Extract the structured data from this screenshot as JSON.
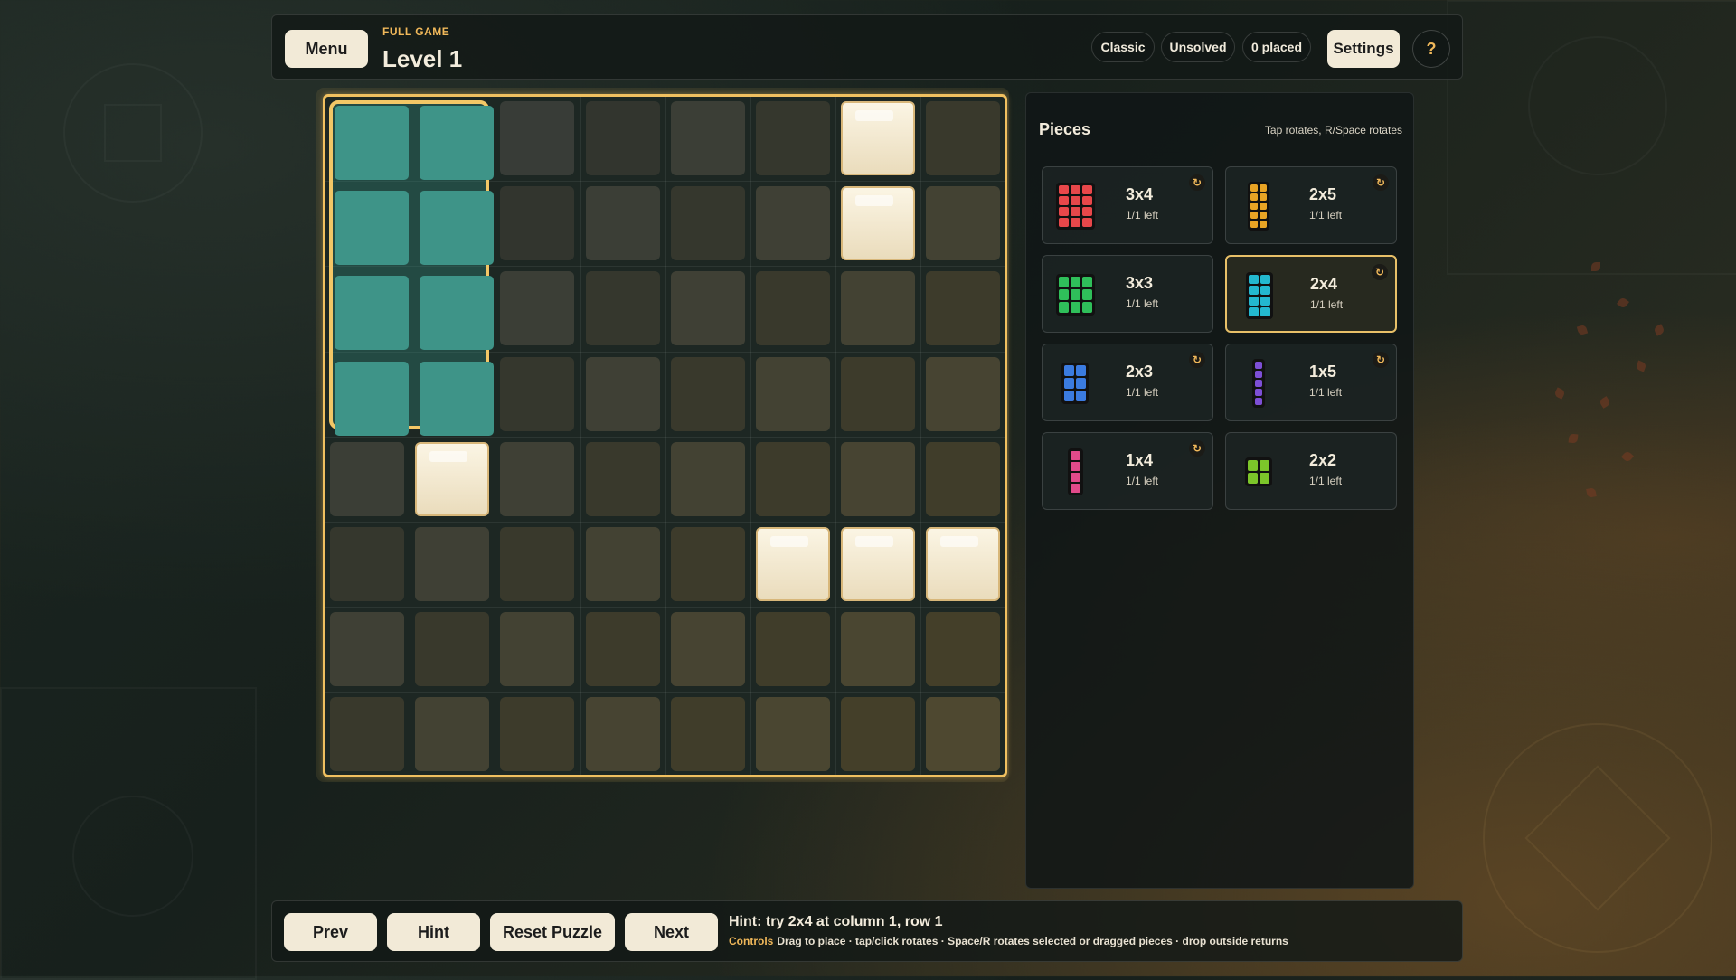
{
  "header": {
    "menu_label": "Menu",
    "game_tag": "FULL GAME",
    "level_title": "Level 1",
    "mode": "Classic",
    "status": "Unsolved",
    "placed": "0 placed",
    "settings_label": "Settings",
    "help_label": "?"
  },
  "board": {
    "rows": 8,
    "cols": 8,
    "blocked_cells": [
      [
        0,
        6
      ],
      [
        1,
        6
      ],
      [
        4,
        1
      ],
      [
        5,
        5
      ],
      [
        5,
        6
      ],
      [
        5,
        7
      ]
    ],
    "placed_piece": {
      "name": "2x4",
      "col": 1,
      "row": 1,
      "color": "#3e9488"
    },
    "accent_color": "#f0c060"
  },
  "pieces_panel": {
    "title": "Pieces",
    "hint": "Tap rotates, R/Space rotates",
    "rotate_icon": "rotate-icon",
    "items": [
      {
        "name": "3x4",
        "left": "1/1 left",
        "color": "#e8474a",
        "cols": 3,
        "rows": 4,
        "rotatable": true,
        "selected": false
      },
      {
        "name": "2x5",
        "left": "1/1 left",
        "color": "#e9a424",
        "cols": 2,
        "rows": 5,
        "rotatable": true,
        "selected": false
      },
      {
        "name": "3x3",
        "left": "1/1 left",
        "color": "#2fbf5a",
        "cols": 3,
        "rows": 3,
        "rotatable": false,
        "selected": false
      },
      {
        "name": "2x4",
        "left": "1/1 left",
        "color": "#23b8cf",
        "cols": 2,
        "rows": 4,
        "rotatable": true,
        "selected": true
      },
      {
        "name": "2x3",
        "left": "1/1 left",
        "color": "#3b7be0",
        "cols": 2,
        "rows": 3,
        "rotatable": true,
        "selected": false
      },
      {
        "name": "1x5",
        "left": "1/1 left",
        "color": "#7d4fd6",
        "cols": 1,
        "rows": 5,
        "rotatable": true,
        "selected": false
      },
      {
        "name": "1x4",
        "left": "1/1 left",
        "color": "#e14a8a",
        "cols": 1,
        "rows": 4,
        "rotatable": true,
        "selected": false
      },
      {
        "name": "2x2",
        "left": "1/1 left",
        "color": "#7cc62a",
        "cols": 2,
        "rows": 2,
        "rotatable": false,
        "selected": false
      }
    ]
  },
  "footer": {
    "prev_label": "Prev",
    "hint_label": "Hint",
    "reset_label": "Reset Puzzle",
    "next_label": "Next",
    "hint_text": "Hint: try 2x4 at column 1, row 1",
    "controls_label": "Controls",
    "controls_text": "Drag to place · tap/click rotates · Space/R rotates selected or dragged pieces · drop outside returns"
  }
}
